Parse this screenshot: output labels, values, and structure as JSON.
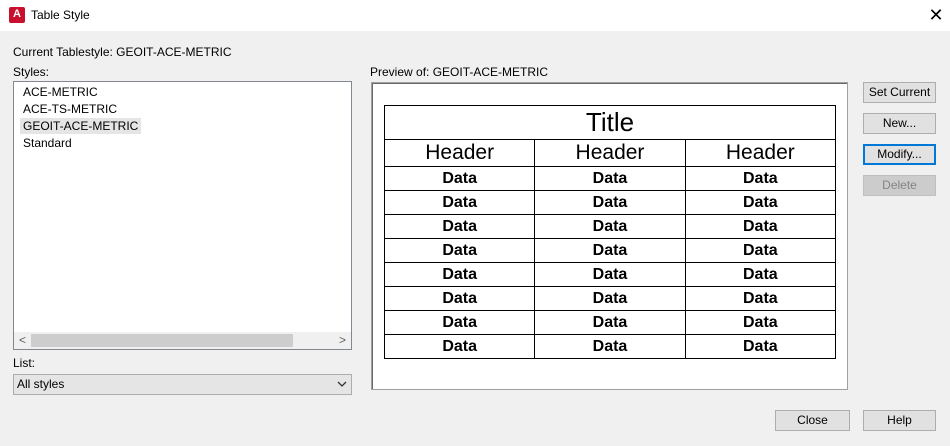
{
  "window": {
    "title": "Table Style",
    "app_icon_letter": "A"
  },
  "current_style": {
    "label": "Current Tablestyle: GEOIT-ACE-METRIC"
  },
  "styles": {
    "label": "Styles:",
    "items": [
      "ACE-METRIC",
      "ACE-TS-METRIC",
      "GEOIT-ACE-METRIC",
      "Standard"
    ],
    "selected_index": 2
  },
  "list": {
    "label": "List:",
    "value": "All styles"
  },
  "preview": {
    "label": "Preview of: GEOIT-ACE-METRIC",
    "title": "Title",
    "headers": [
      "Header",
      "Header",
      "Header"
    ],
    "data_cell": "Data",
    "data_rows": 8
  },
  "buttons": {
    "set_current": "Set Current",
    "new": "New...",
    "modify": "Modify...",
    "delete": "Delete",
    "close": "Close",
    "help": "Help"
  }
}
